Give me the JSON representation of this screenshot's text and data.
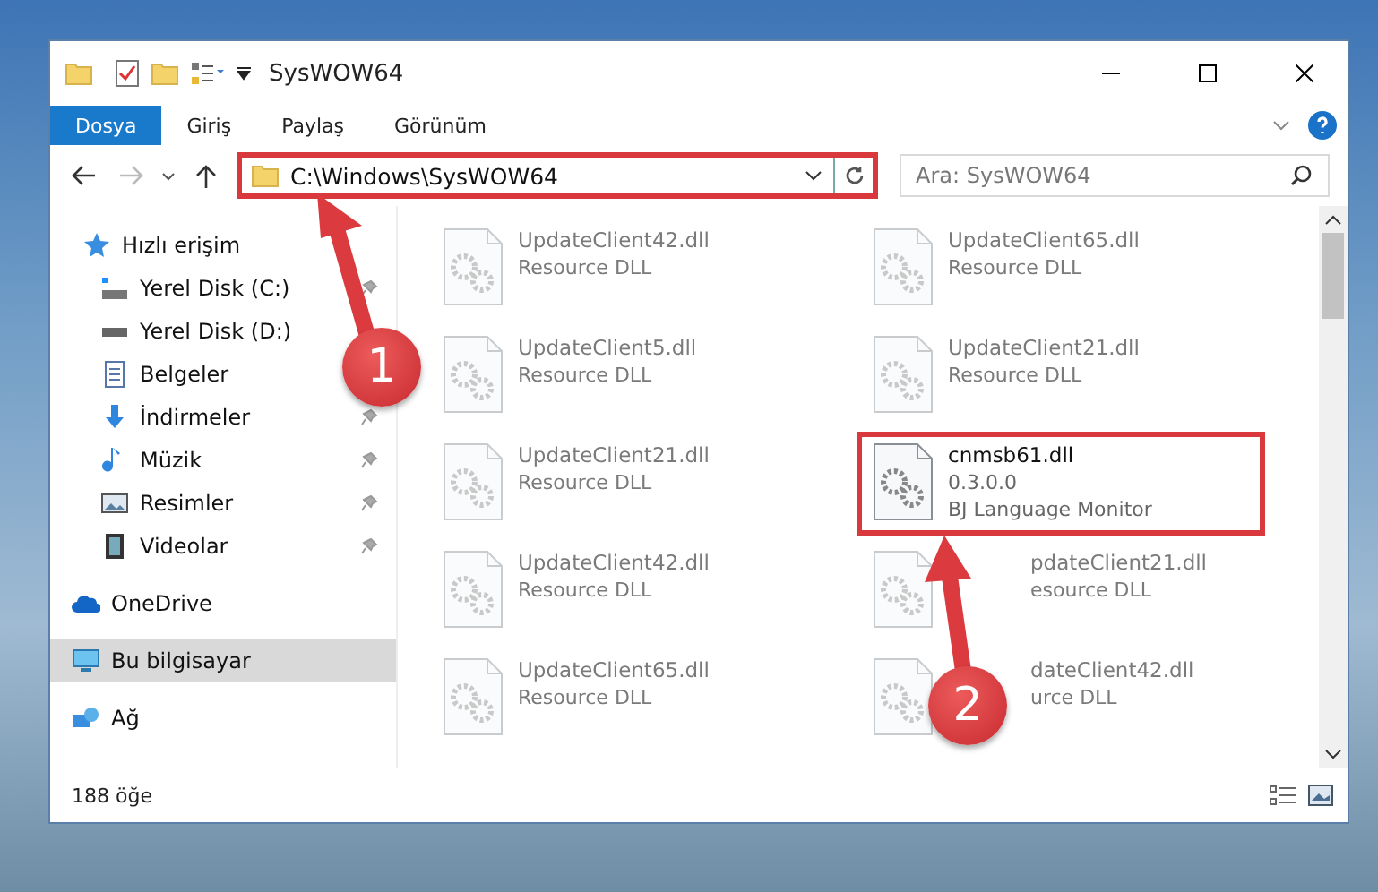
{
  "window": {
    "title": "SysWOW64"
  },
  "ribbon_tabs": [
    {
      "label": "Dosya",
      "selected": true
    },
    {
      "label": "Giriş",
      "selected": false
    },
    {
      "label": "Paylaş",
      "selected": false
    },
    {
      "label": "Görünüm",
      "selected": false
    }
  ],
  "address": {
    "path": "C:\\Windows\\SysWOW64",
    "highlighted": true
  },
  "search": {
    "placeholder": "Ara: SysWOW64"
  },
  "sidebar": {
    "items": [
      {
        "label": "Hızlı erişim",
        "kind": "star",
        "selected": false,
        "children": [
          {
            "label": "Yerel Disk (C:)",
            "kind": "system-drive",
            "pinned": true,
            "selected": false
          },
          {
            "label": "Yerel Disk (D:)",
            "kind": "drive",
            "pinned": false,
            "selected": false
          },
          {
            "label": "Belgeler",
            "kind": "document",
            "pinned": false,
            "selected": false
          },
          {
            "label": "İndirmeler",
            "kind": "download",
            "pinned": true,
            "selected": false
          },
          {
            "label": "Müzik",
            "kind": "music",
            "pinned": true,
            "selected": false
          },
          {
            "label": "Resimler",
            "kind": "picture",
            "pinned": true,
            "selected": false
          },
          {
            "label": "Videolar",
            "kind": "video",
            "pinned": true,
            "selected": false
          }
        ]
      },
      {
        "label": "OneDrive",
        "kind": "cloud",
        "selected": false
      },
      {
        "label": "Bu bilgisayar",
        "kind": "computer",
        "selected": true
      },
      {
        "label": "Ağ",
        "kind": "network",
        "selected": false
      }
    ]
  },
  "files": [
    {
      "name": "UpdateClient42.dll",
      "lines": [
        "Resource DLL"
      ],
      "blurred": true,
      "highlighted": false
    },
    {
      "name": "UpdateClient65.dll",
      "lines": [
        "Resource DLL"
      ],
      "blurred": true,
      "highlighted": false
    },
    {
      "name": "UpdateClient5.dll",
      "lines": [
        "Resource DLL"
      ],
      "blurred": true,
      "highlighted": false
    },
    {
      "name": "UpdateClient21.dll",
      "lines": [
        "Resource DLL"
      ],
      "blurred": true,
      "highlighted": false
    },
    {
      "name": "UpdateClient21.dll",
      "lines": [
        "Resource DLL"
      ],
      "blurred": true,
      "highlighted": false
    },
    {
      "name": "cnmsb61.dll",
      "lines": [
        "0.3.0.0",
        "BJ Language Monitor"
      ],
      "blurred": false,
      "highlighted": true
    },
    {
      "name": "UpdateClient42.dll",
      "lines": [
        "Resource DLL"
      ],
      "blurred": true,
      "highlighted": false
    },
    {
      "name": "pdateClient21.dll",
      "lines": [
        "esource DLL"
      ],
      "blurred": true,
      "highlighted": false,
      "partly_hidden": true
    },
    {
      "name": "UpdateClient65.dll",
      "lines": [
        "Resource DLL"
      ],
      "blurred": true,
      "highlighted": false
    },
    {
      "name": "dateClient42.dll",
      "lines": [
        "urce DLL"
      ],
      "blurred": true,
      "highlighted": false,
      "partly_hidden": true
    }
  ],
  "status_bar": {
    "count": "188 öğe"
  },
  "callouts": [
    {
      "number": "1"
    },
    {
      "number": "2"
    }
  ]
}
